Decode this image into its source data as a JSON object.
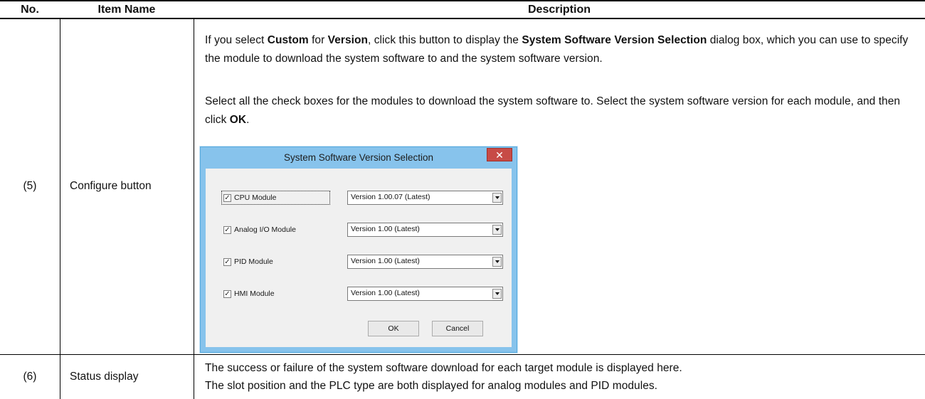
{
  "table": {
    "headers": {
      "no": "No.",
      "item": "Item Name",
      "desc": "Description"
    },
    "rows": [
      {
        "no": "(5)",
        "item": "Configure button",
        "desc": {
          "p1_a": "If you select ",
          "p1_b": "Custom",
          "p1_c": " for ",
          "p1_d": "Version",
          "p1_e": ", click this button to display the ",
          "p1_f": "System Software Version Selection",
          "p1_g": " dialog box, which you can use to specify the module to download the system software to and the system software version.",
          "p2_a": "Select all the check boxes for the modules to download the system software to. Select the system software version for each module, and then click ",
          "p2_b": "OK",
          "p2_c": "."
        }
      },
      {
        "no": "(6)",
        "item": "Status display",
        "desc": {
          "line1": "The success or failure of the system software download for each target module is displayed here.",
          "line2": "The slot position and the PLC type are both displayed for analog modules and PID modules."
        }
      }
    ]
  },
  "dialog": {
    "title": "System Software Version Selection",
    "close_glyph": "✕",
    "modules": [
      {
        "label": "CPU Module",
        "checked": true,
        "version": "Version 1.00.07 (Latest)"
      },
      {
        "label": "Analog I/O Module",
        "checked": true,
        "version": "Version 1.00 (Latest)"
      },
      {
        "label": "PID Module",
        "checked": true,
        "version": "Version 1.00 (Latest)"
      },
      {
        "label": "HMI Module",
        "checked": true,
        "version": "Version 1.00 (Latest)"
      }
    ],
    "check_glyph": "✓",
    "ok_label": "OK",
    "cancel_label": "Cancel"
  },
  "colors": {
    "title_bar": "#87c3ec",
    "close_button": "#c74b46",
    "dialog_client": "#f0f0f0"
  }
}
